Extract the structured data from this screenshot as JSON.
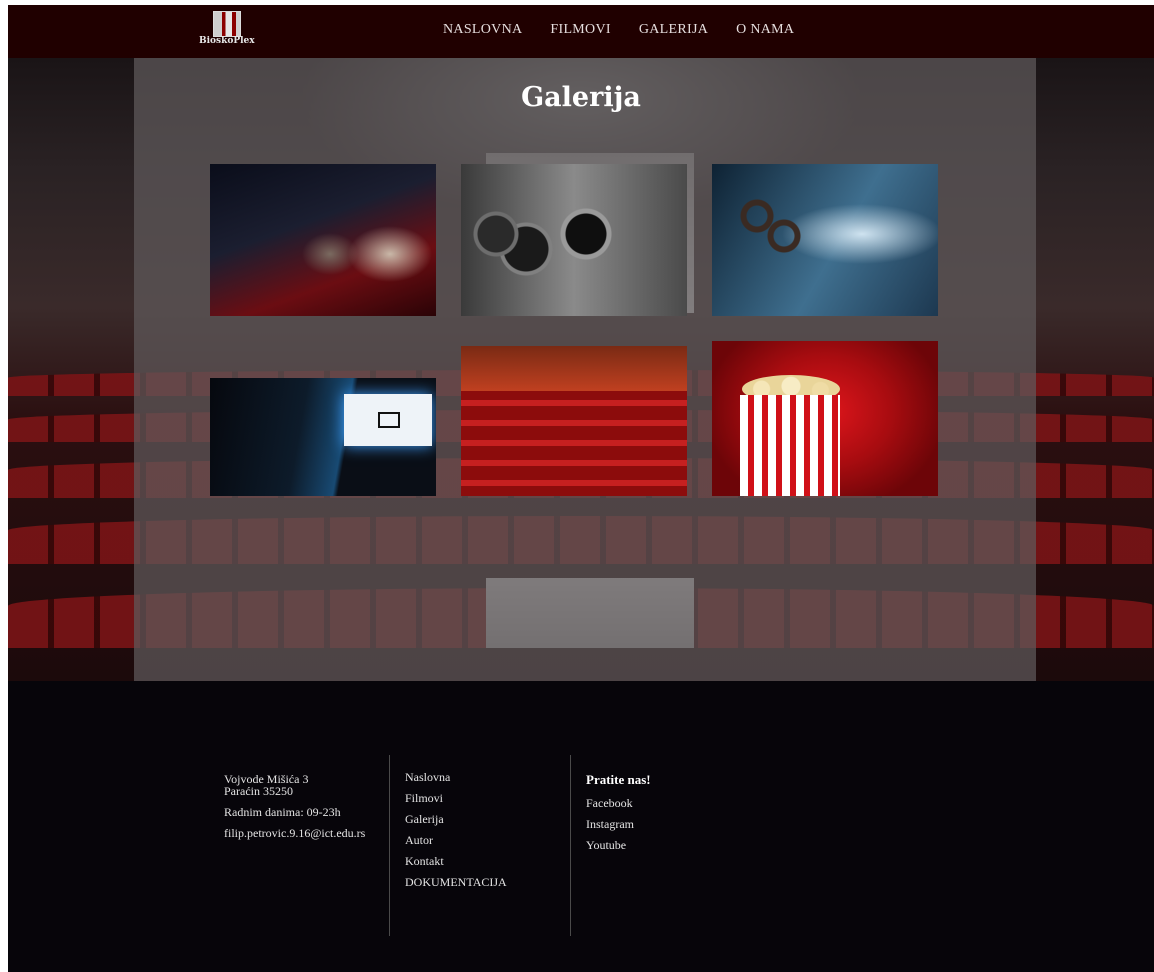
{
  "brand": {
    "logo_text": "BioskoPlex"
  },
  "nav": {
    "items": [
      {
        "label": "NASLOVNA"
      },
      {
        "label": "FILMOVI"
      },
      {
        "label": "GALERIJA"
      },
      {
        "label": "O NAMA"
      }
    ]
  },
  "main": {
    "title": "Galerija",
    "gallery": [
      {
        "subject": "audience-3d-glasses"
      },
      {
        "subject": "vintage-camera"
      },
      {
        "subject": "film-projector"
      },
      {
        "subject": "dolby-cinema-hall"
      },
      {
        "subject": "red-cinema-lounge"
      },
      {
        "subject": "popcorn-box"
      }
    ]
  },
  "footer": {
    "address_line1": "Vojvode Mišića 3",
    "address_line2": "Paraćin 35250",
    "hours": "Radnim danima: 09-23h",
    "email": "filip.petrovic.9.16@ict.edu.rs",
    "links": [
      "Naslovna",
      "Filmovi",
      "Galerija",
      "Autor",
      "Kontakt",
      "DOKUMENTACIJA"
    ],
    "social_title": "Pratite nas!",
    "social": [
      "Facebook",
      "Instagram",
      "Youtube"
    ]
  },
  "colors": {
    "nav_bg": "#200000",
    "footer_bg": "#07050a",
    "panel_overlay": "#5f5a5c"
  }
}
